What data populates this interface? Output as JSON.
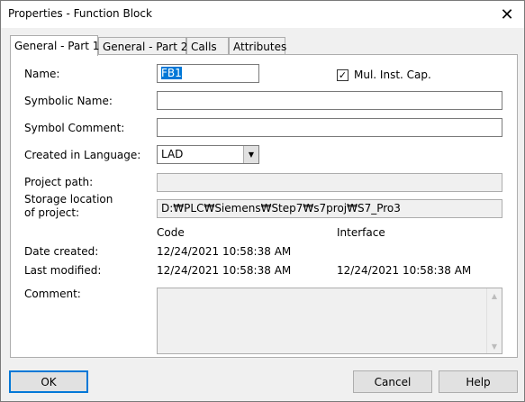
{
  "window": {
    "title": "Properties - Function Block"
  },
  "tabs": [
    {
      "label": "General - Part 1"
    },
    {
      "label": "General - Part 2"
    },
    {
      "label": "Calls"
    },
    {
      "label": "Attributes"
    }
  ],
  "form": {
    "name_label": "Name:",
    "name_value": "FB1",
    "mul_inst_label": "Mul. Inst. Cap.",
    "mul_inst_checked": true,
    "symbolic_name_label": "Symbolic Name:",
    "symbolic_name_value": "",
    "symbol_comment_label": "Symbol Comment:",
    "symbol_comment_value": "",
    "language_label": "Created in Language:",
    "language_value": "LAD",
    "project_path_label": "Project path:",
    "project_path_value": "",
    "storage_label_line1": "Storage location",
    "storage_label_line2": "of project:",
    "storage_value": "D:₩PLC₩Siemens₩Step7₩s7proj₩S7_Pro3",
    "code_header": "Code",
    "interface_header": "Interface",
    "date_created_label": "Date created:",
    "date_created_code": "12/24/2021 10:58:38 AM",
    "last_modified_label": "Last modified:",
    "last_modified_code": "12/24/2021 10:58:38 AM",
    "last_modified_interface": "12/24/2021 10:58:38 AM",
    "comment_label": "Comment:",
    "comment_value": ""
  },
  "buttons": {
    "ok": "OK",
    "cancel": "Cancel",
    "help": "Help"
  },
  "icons": {
    "close": "close-icon",
    "check": "checkmark-icon",
    "dropdown": "chevron-down-icon",
    "scroll_up": "scroll-up-icon",
    "scroll_down": "scroll-down-icon"
  },
  "colors": {
    "selection": "#0078d7",
    "panel": "#ffffff",
    "dialog": "#f0f0f0"
  }
}
